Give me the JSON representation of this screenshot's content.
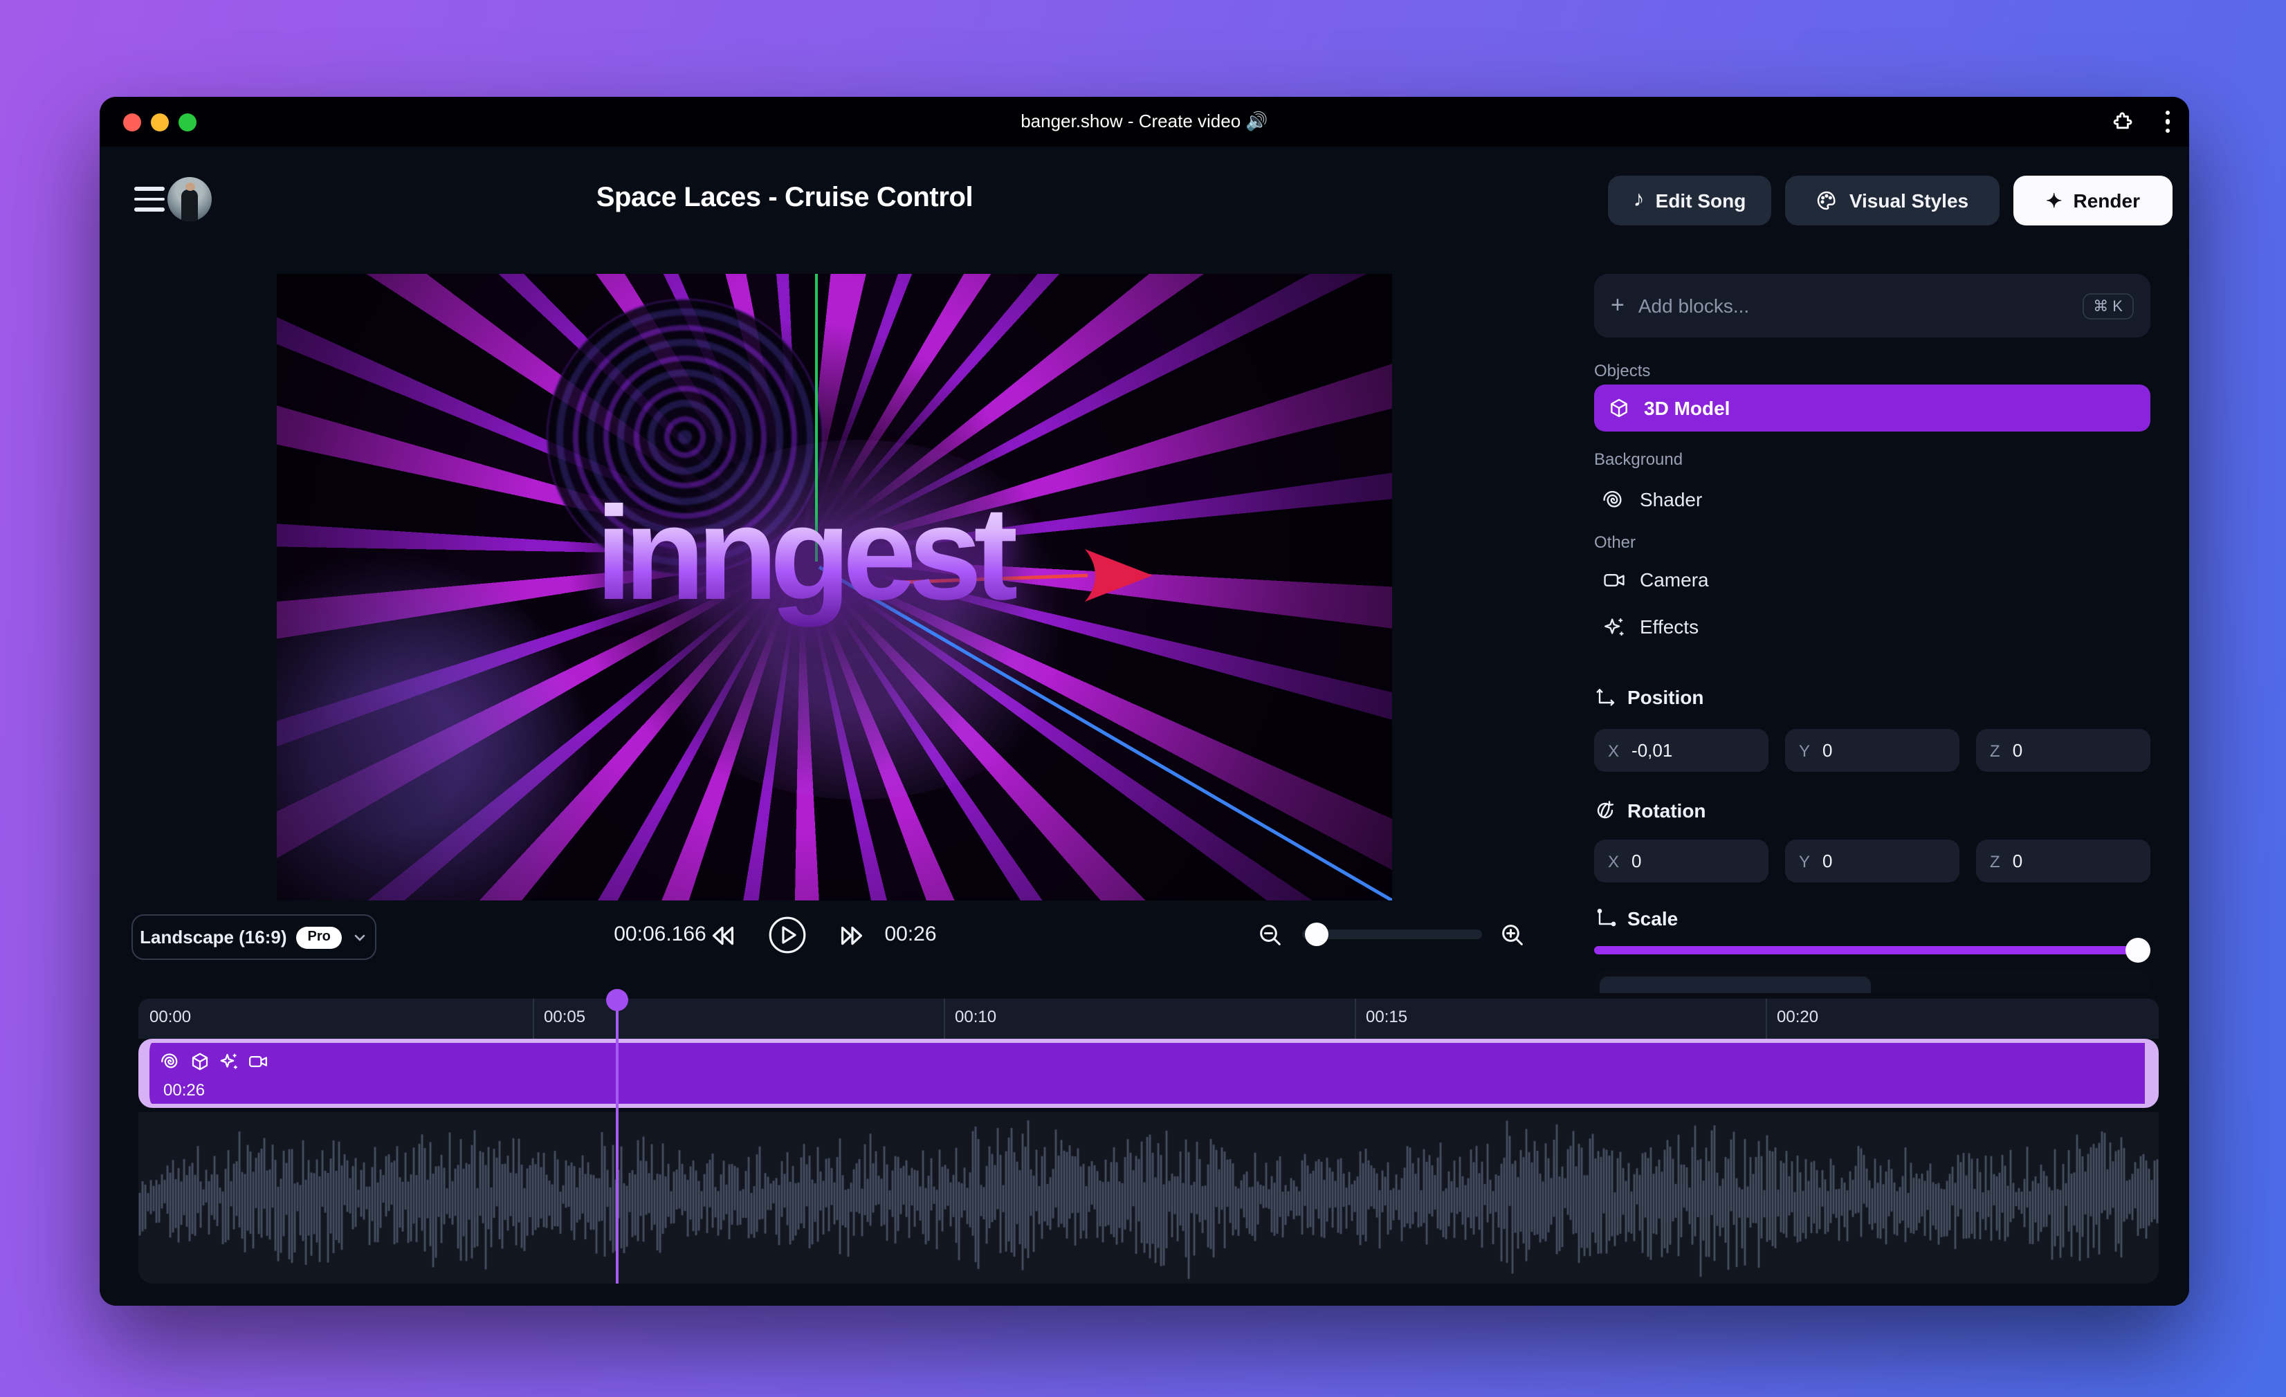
{
  "window": {
    "title": "banger.show - Create video 🔊"
  },
  "header": {
    "project_title": "Space Laces - Cruise Control",
    "edit_song": "Edit Song",
    "visual_styles": "Visual Styles",
    "render": "Render"
  },
  "preview": {
    "watermark_text": "inngest"
  },
  "playback": {
    "aspect_label": "Landscape (16:9)",
    "pro_badge": "Pro",
    "current_time": "00:06.166",
    "total_time": "00:26"
  },
  "panel": {
    "add_blocks": {
      "label": "Add blocks...",
      "shortcut": "⌘ K"
    },
    "objects_label": "Objects",
    "model_item": "3D Model",
    "background_label": "Background",
    "shader_item": "Shader",
    "other_label": "Other",
    "camera_item": "Camera",
    "effects_item": "Effects",
    "position": {
      "label": "Position",
      "x_label": "X",
      "x": "-0,01",
      "y_label": "Y",
      "y": "0",
      "z_label": "Z",
      "z": "0"
    },
    "rotation": {
      "label": "Rotation",
      "x_label": "X",
      "x": "0",
      "y_label": "Y",
      "y": "0",
      "z_label": "Z",
      "z": "0"
    },
    "scale": {
      "label": "Scale",
      "value_pct": 98
    }
  },
  "timeline": {
    "ruler_labels": [
      "00:00",
      "00:05",
      "00:10",
      "00:15",
      "00:20"
    ],
    "clip_duration": "00:26",
    "playhead_time": "00:06.166"
  },
  "colors": {
    "accent_purple": "#8b23dc",
    "clip_fill": "#7e1fd2",
    "clip_border": "#d7b1f6",
    "slider_purple": "#9b2ef2",
    "playhead": "#a55bf0",
    "render_button": "#fbfbfd",
    "traffic_red": "#ff5f57",
    "traffic_yellow": "#febc2e",
    "traffic_green": "#28c840"
  }
}
